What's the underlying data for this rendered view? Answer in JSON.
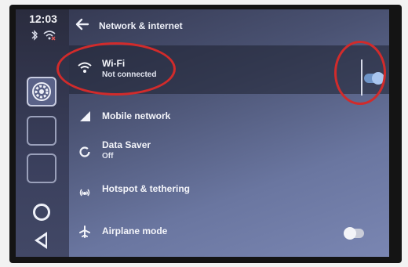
{
  "rail": {
    "clock": "12:03",
    "status_icons": [
      "bluetooth-icon",
      "wifi-off-icon"
    ]
  },
  "header": {
    "title": "Network & internet"
  },
  "settings": {
    "wifi": {
      "label": "Wi-Fi",
      "status": "Not connected",
      "toggle_on": true
    },
    "mobile": {
      "label": "Mobile network"
    },
    "data_saver": {
      "label": "Data Saver",
      "status": "Off"
    },
    "hotspot": {
      "label": "Hotspot & tethering"
    },
    "airplane": {
      "label": "Airplane mode",
      "toggle_on": false
    }
  },
  "colors": {
    "annotation": "#d12b2b",
    "toggle_on_track": "#6f95c8",
    "toggle_on_knob": "#a9c6ef",
    "toggle_off_track": "#c9ccd8",
    "toggle_off_knob": "#f3f4f8"
  }
}
